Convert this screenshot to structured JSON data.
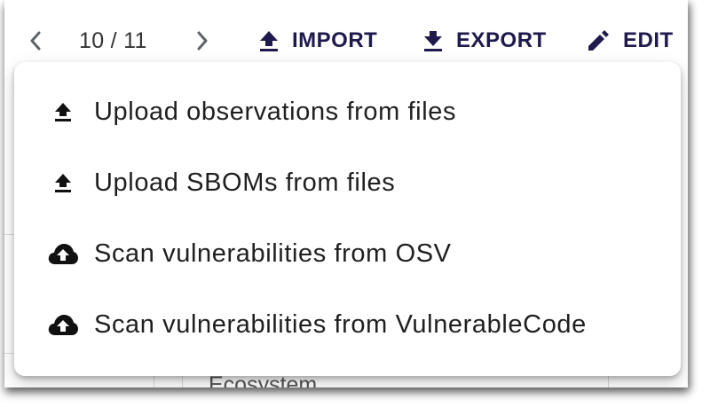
{
  "toolbar": {
    "prev_icon": "chevron-left-icon",
    "next_icon": "chevron-right-icon",
    "pager_text": "10 / 11",
    "import_label": "IMPORT",
    "import_icon": "upload-icon",
    "export_label": "EXPORT",
    "export_icon": "download-icon",
    "edit_label": "EDIT",
    "edit_icon": "pencil-icon",
    "accent_color": "#1e1a4d"
  },
  "menu": {
    "items": [
      {
        "label": "Upload observations from files",
        "icon": "upload-icon"
      },
      {
        "label": "Upload SBOMs from files",
        "icon": "upload-icon"
      },
      {
        "label": "Scan vulnerabilities from OSV",
        "icon": "cloud-upload-icon"
      },
      {
        "label": "Scan vulnerabilities from VulnerableCode",
        "icon": "cloud-upload-icon"
      }
    ]
  },
  "background": {
    "partial_label": "Ecosystem"
  }
}
